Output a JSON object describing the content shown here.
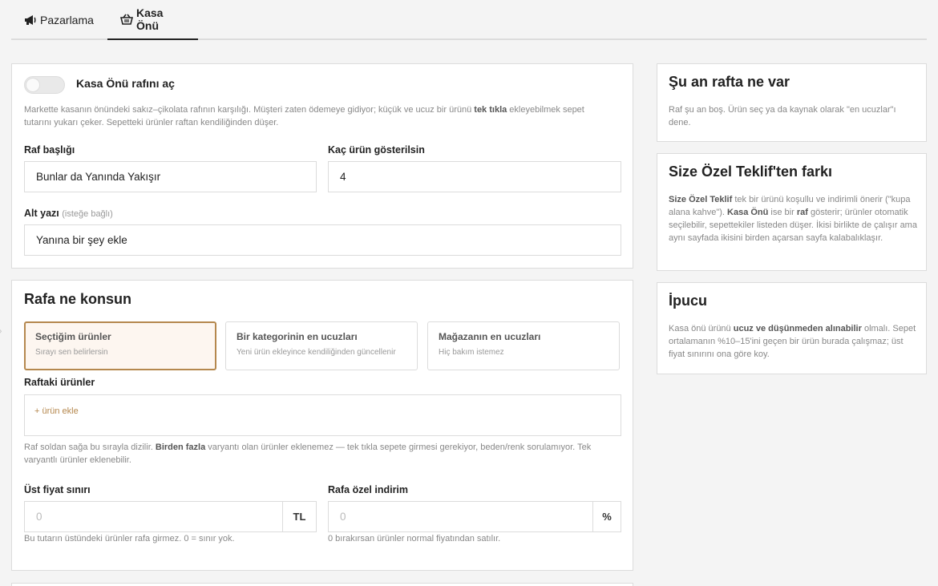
{
  "tabs": [
    {
      "label": "Pazarlama",
      "icon": "megaphone-icon"
    },
    {
      "label": "Kasa Önü",
      "icon": "basket-icon"
    }
  ],
  "main": {
    "toggle_label": "Kasa Önü rafını aç",
    "toggle_on": false,
    "desc_1": "Markette kasanın önündeki sakız–çikolata rafının karşılığı. Müşteri zaten ödemeye gidiyor; küçük ve ucuz bir ürünü ",
    "desc_bold": "tek tıkla",
    "desc_2": " ekleyebilmek sepet tutarını yukarı çeker. Sepetteki ürünler raftan kendiliğinden düşer.",
    "title_label": "Raf başlığı",
    "title_value": "Bunlar da Yanında Yakışır",
    "count_label": "Kaç ürün gösterilsin",
    "count_value": "4",
    "subtitle_label": "Alt yazı",
    "subtitle_optional": "(isteğe bağlı)",
    "subtitle_value": "Yanına bir şey ekle"
  },
  "source": {
    "heading": "Rafa ne konsun",
    "options": [
      {
        "title": "Seçtiğim ürünler",
        "sub": "Sırayı sen belirlersin",
        "selected": true
      },
      {
        "title": "Bir kategorinin en ucuzları",
        "sub": "Yeni ürün ekleyince kendiliğinden güncellenir",
        "selected": false
      },
      {
        "title": "Mağazanın en ucuzları",
        "sub": "Hiç bakım istemez",
        "selected": false
      }
    ],
    "products_label": "Raftaki ürünler",
    "add_link": "+ ürün ekle",
    "note_1": "Raf soldan sağa bu sırayla dizilir. ",
    "note_bold": "Birden fazla",
    "note_2": " varyantı olan ürünler eklenemez — tek tıkla sepete girmesi gerekiyor, beden/renk sorulamıyor. Tek varyantlı ürünler eklenebilir.",
    "max_price_label": "Üst fiyat sınırı",
    "max_price_placeholder": "0",
    "max_price_unit": "TL",
    "max_price_help": "Bu tutarın üstündeki ürünler rafa girmez. 0 = sınır yok.",
    "discount_label": "Rafa özel indirim",
    "discount_placeholder": "0",
    "discount_unit": "%",
    "discount_help": "0 bırakırsan ürünler normal fiyatından satılır."
  },
  "side": {
    "now_title": "Şu an rafta ne var",
    "now_desc": "Raf şu an boş. Ürün seç ya da kaynak olarak \"en ucuzlar\"ı dene.",
    "diff_title": "Size Özel Teklif'ten farkı",
    "diff_b1": "Size Özel Teklif",
    "diff_t1": " tek bir ürünü koşullu ve indirimli önerir (\"kupa alana kahve\"). ",
    "diff_b2": "Kasa Önü",
    "diff_t2": " ise bir ",
    "diff_b3": "raf",
    "diff_t3": " gösterir; ürünler otomatik seçilebilir, sepettekiler listeden düşer. İkisi birlikte de çalışır ama aynı sayfada ikisini birden açarsan sayfa kalabalıklaşır.",
    "tip_title": "İpucu",
    "tip_t1": "Kasa önü ürünü ",
    "tip_b1": "ucuz ve düşünmeden alınabilir",
    "tip_t2": " olmalı. Sepet ortalamanın %10–15'ini geçen bir ürün burada çalışmaz; üst fiyat sınırını ona göre koy."
  }
}
